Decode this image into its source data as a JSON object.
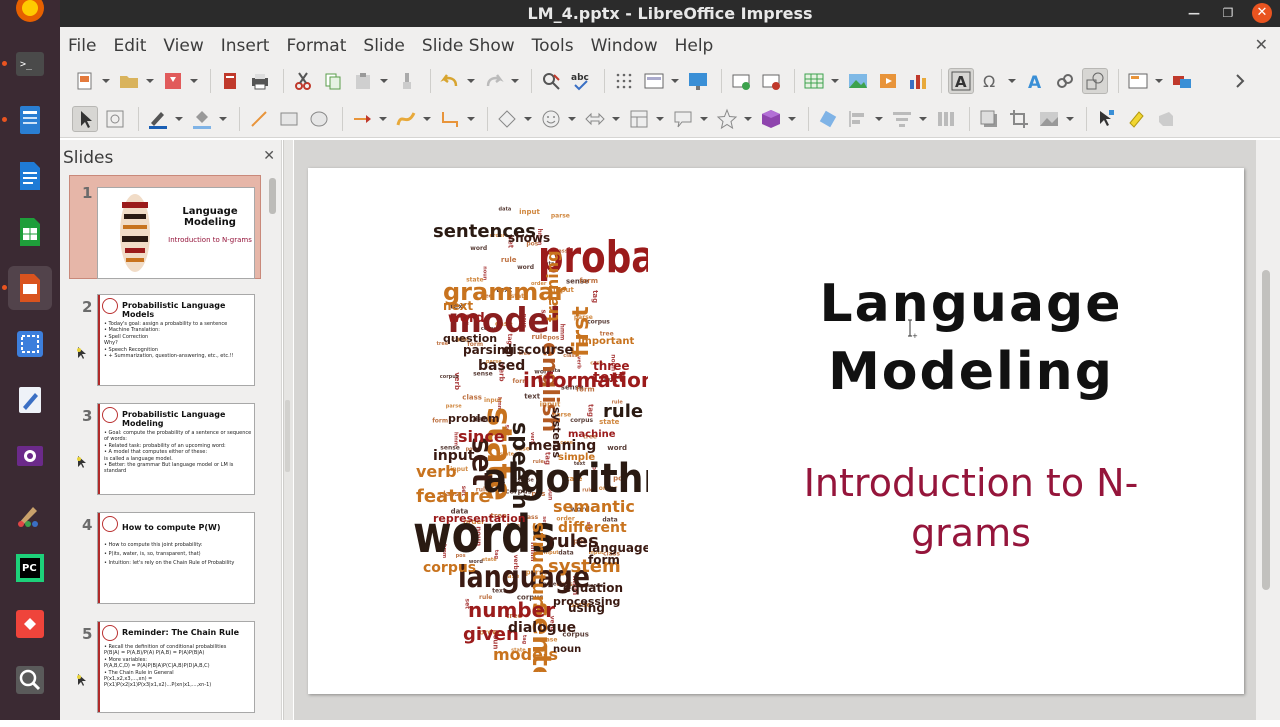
{
  "window": {
    "title": "LM_4.pptx - LibreOffice Impress"
  },
  "menu": {
    "items": [
      "File",
      "Edit",
      "View",
      "Insert",
      "Format",
      "Slide",
      "Slide Show",
      "Tools",
      "Window",
      "Help"
    ]
  },
  "slides_pane": {
    "title": "Slides",
    "thumbs": [
      {
        "number": "1",
        "title": "Language Modeling",
        "subtitle": "Introduction to N-grams",
        "selected": true
      },
      {
        "number": "2",
        "title": "Probabilistic Language Models",
        "body": "• Today's goal: assign a probability to a sentence\n  • Machine Translation:\n  • Spell Correction\nWhy?\n  • Speech Recognition\n  • + Summarization, question-answering, etc., etc.!!"
      },
      {
        "number": "3",
        "title": "Probabilistic Language Modeling",
        "body": "• Goal: compute the probability of a sentence or sequence of words:\n• Related task: probability of an upcoming word:\n• A model that computes either of these:\n  is called a language model.\n• Better: the grammar  But language model or LM is standard"
      },
      {
        "number": "4",
        "title": "How to compute P(W)",
        "body": "• How to compute this joint probability:\n  • P(its, water, is, so, transparent, that)\n• Intuition: let's rely on the Chain Rule of Probability"
      },
      {
        "number": "5",
        "title": "Reminder: The Chain Rule",
        "body": "• Recall the definition of conditional probabilities\n  P(B|A) = P(A,B)/P(A)   P(A,B) = P(A)P(B|A)\n• More variables:\n  P(A,B,C,D) = P(A)P(B|A)P(C|A,B)P(D|A,B,C)\n• The Chain Rule in General\n  P(x1,x2,x3,...,xn) = P(x1)P(x2|x1)P(x3|x1,x2)...P(xn|x1,...,xn-1)"
      }
    ]
  },
  "slide": {
    "title_line1": "Language",
    "title_line2": "Modeling",
    "subtitle_line1": "Introduction to N-",
    "subtitle_line2": "grams"
  },
  "wordcloud": {
    "words": [
      {
        "t": "probability",
        "s": 44,
        "c": "#9b1b1b",
        "bold": true
      },
      {
        "t": "sentences",
        "s": 18,
        "c": "#2a1a12",
        "bold": true
      },
      {
        "t": "grammar",
        "s": 24,
        "c": "#c8731e",
        "bold": true
      },
      {
        "t": "model",
        "s": 34,
        "c": "#8a1e1e",
        "bold": true
      },
      {
        "t": "english",
        "s": 22,
        "c": "#b35a22",
        "bold": true
      },
      {
        "t": "training",
        "s": 16,
        "c": "#c8731e",
        "bold": true
      },
      {
        "t": "first",
        "s": 22,
        "c": "#c8731e",
        "bold": true
      },
      {
        "t": "state",
        "s": 34,
        "c": "#c8731e",
        "bold": true
      },
      {
        "t": "information",
        "s": 20,
        "c": "#9b1b1b",
        "bold": true
      },
      {
        "t": "based",
        "s": 14,
        "c": "#3a1a12",
        "bold": true
      },
      {
        "t": "speech",
        "s": 22,
        "c": "#2a1a12",
        "bold": true
      },
      {
        "t": "set",
        "s": 28,
        "c": "#3a1a12",
        "bold": true
      },
      {
        "t": "rule",
        "s": 18,
        "c": "#2a1a12",
        "bold": true
      },
      {
        "t": "algorithm",
        "s": 40,
        "c": "#2a1a12",
        "bold": true
      },
      {
        "t": "feature",
        "s": 18,
        "c": "#c8731e",
        "bold": true
      },
      {
        "t": "verb",
        "s": 16,
        "c": "#c8731e",
        "bold": true
      },
      {
        "t": "words",
        "s": 52,
        "c": "#2a1a12",
        "bold": true
      },
      {
        "t": "language",
        "s": 30,
        "c": "#3a1a12",
        "bold": true
      },
      {
        "t": "structure",
        "s": 18,
        "c": "#c8731e",
        "bold": true
      },
      {
        "t": "semantic",
        "s": 16,
        "c": "#c8731e",
        "bold": true
      },
      {
        "t": "rules",
        "s": 18,
        "c": "#3a1a12",
        "bold": true
      },
      {
        "t": "system",
        "s": 18,
        "c": "#c8731e",
        "bold": true
      },
      {
        "t": "sentence",
        "s": 26,
        "c": "#c8731e",
        "bold": true
      },
      {
        "t": "number",
        "s": 20,
        "c": "#9b1b1b",
        "bold": true
      },
      {
        "t": "given",
        "s": 18,
        "c": "#9b1b1b",
        "bold": true
      },
      {
        "t": "models",
        "s": 16,
        "c": "#c8731e",
        "bold": true
      },
      {
        "t": "dialogue",
        "s": 14,
        "c": "#3a1a12",
        "bold": true
      },
      {
        "t": "equation",
        "s": 12,
        "c": "#3a1a12",
        "bold": true
      },
      {
        "t": "using",
        "s": 12,
        "c": "#3a1a12",
        "bold": true
      },
      {
        "t": "corpus",
        "s": 14,
        "c": "#c8731e",
        "bold": true
      },
      {
        "t": "representation",
        "s": 11,
        "c": "#9b1b1b",
        "bold": true
      },
      {
        "t": "input",
        "s": 14,
        "c": "#3a1a12",
        "bold": true
      },
      {
        "t": "since",
        "s": 16,
        "c": "#9b1b1b",
        "bold": true
      },
      {
        "t": "meaning",
        "s": 14,
        "c": "#3a1a12",
        "bold": true
      },
      {
        "t": "discourse",
        "s": 13,
        "c": "#3a1a12",
        "bold": true
      },
      {
        "t": "parsing",
        "s": 12,
        "c": "#3a1a12",
        "bold": true
      },
      {
        "t": "question",
        "s": 11,
        "c": "#3a1a12",
        "bold": true
      },
      {
        "t": "word",
        "s": 13,
        "c": "#9b1b1b",
        "bold": true
      },
      {
        "t": "next",
        "s": 12,
        "c": "#c8731e",
        "bold": true
      },
      {
        "t": "text",
        "s": 14,
        "c": "#9b1b1b",
        "bold": true
      },
      {
        "t": "three",
        "s": 12,
        "c": "#9b1b1b",
        "bold": true
      },
      {
        "t": "important",
        "s": 10,
        "c": "#c8731e",
        "bold": true
      },
      {
        "t": "different",
        "s": 14,
        "c": "#c8731e",
        "bold": true
      },
      {
        "t": "languages",
        "s": 12,
        "c": "#3a1a12",
        "bold": true
      },
      {
        "t": "form",
        "s": 12,
        "c": "#3a1a12",
        "bold": true
      },
      {
        "t": "processing",
        "s": 11,
        "c": "#3a1a12",
        "bold": true
      },
      {
        "t": "problem",
        "s": 11,
        "c": "#3a1a12",
        "bold": true
      },
      {
        "t": "systems",
        "s": 11,
        "c": "#3a1a12",
        "bold": true
      },
      {
        "t": "machine",
        "s": 10,
        "c": "#9b1b1b",
        "bold": true
      },
      {
        "t": "simple",
        "s": 10,
        "c": "#c8731e",
        "bold": true
      },
      {
        "t": "noun",
        "s": 10,
        "c": "#3a1a12",
        "bold": true
      },
      {
        "t": "shows",
        "s": 12,
        "c": "#3a1a12",
        "bold": true
      }
    ]
  }
}
